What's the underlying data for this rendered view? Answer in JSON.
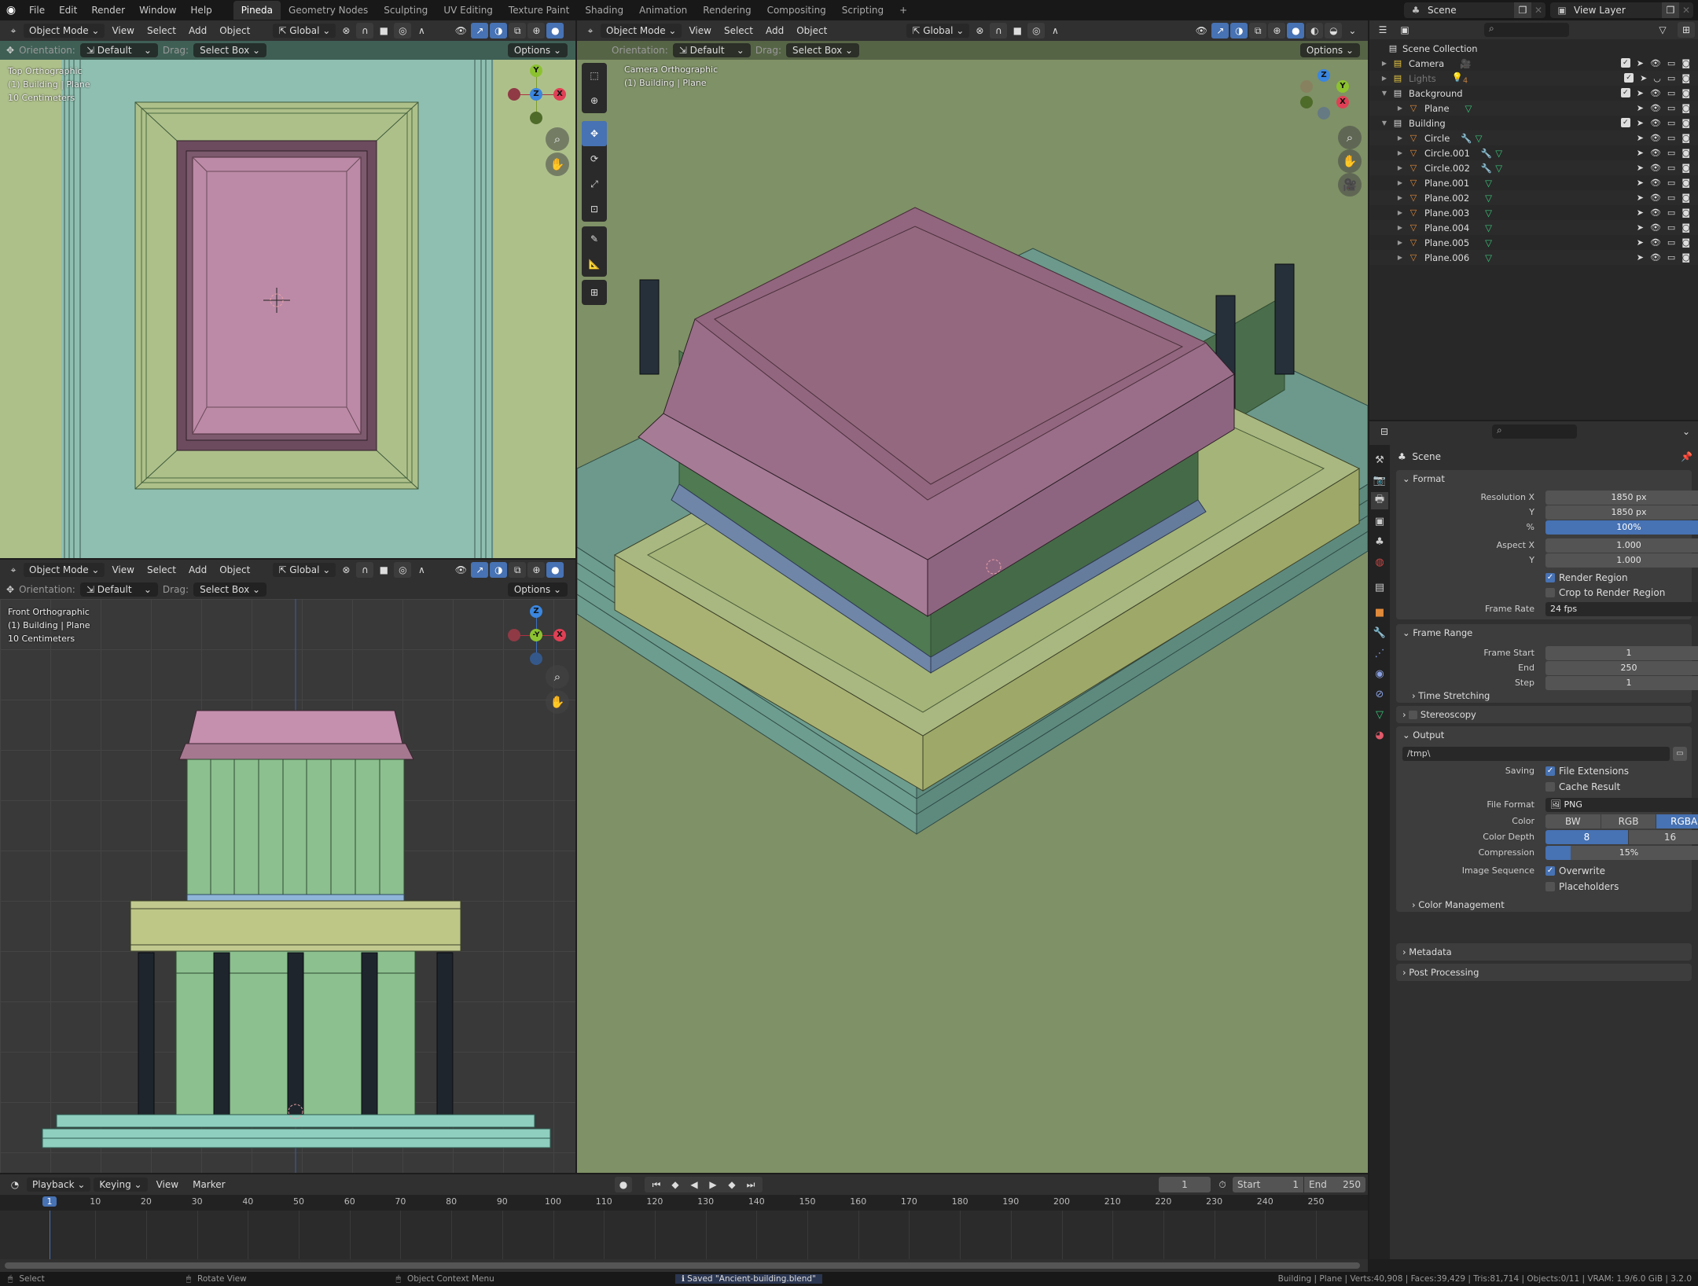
{
  "topbar": {
    "menus": [
      "File",
      "Edit",
      "Render",
      "Window",
      "Help"
    ],
    "workspaces": [
      "Pineda",
      "Geometry Nodes",
      "Sculpting",
      "UV Editing",
      "Texture Paint",
      "Shading",
      "Animation",
      "Rendering",
      "Compositing",
      "Scripting"
    ],
    "active_workspace": "Pineda",
    "add_tab": "+",
    "scene": "Scene",
    "view_layer": "View Layer"
  },
  "viewport_header": {
    "mode": "Object Mode",
    "menus": [
      "View",
      "Select",
      "Add",
      "Object"
    ],
    "transform_orientation": "Global",
    "orientation_label": "Orientation:",
    "orientation_value": "Default",
    "drag_label": "Drag:",
    "drag_value": "Select Box",
    "options": "Options"
  },
  "viewports": {
    "top": {
      "view": "Top Orthographic",
      "object": "(1) Building | Plane",
      "scale": "10 Centimeters"
    },
    "front": {
      "view": "Front Orthographic",
      "object": "(1) Building | Plane",
      "scale": "10 Centimeters"
    },
    "camera": {
      "view": "Camera Orthographic",
      "object": "(1) Building | Plane"
    }
  },
  "gizmo_labels": {
    "x": "X",
    "y": "Y",
    "z": "Z",
    "neg_y": "-Y"
  },
  "outliner": {
    "root": "Scene Collection",
    "items": [
      {
        "name": "Camera",
        "type": "collection",
        "depth": 0,
        "expanded": false,
        "extra": "camera-data"
      },
      {
        "name": "Lights",
        "type": "collection",
        "depth": 0,
        "expanded": false,
        "extra": "light-data",
        "count": "4",
        "disabled": true
      },
      {
        "name": "Background",
        "type": "collection",
        "depth": 0,
        "expanded": true
      },
      {
        "name": "Plane",
        "type": "mesh",
        "depth": 1
      },
      {
        "name": "Building",
        "type": "collection",
        "depth": 0,
        "expanded": true
      },
      {
        "name": "Circle",
        "type": "mesh",
        "depth": 1,
        "modifier": true
      },
      {
        "name": "Circle.001",
        "type": "mesh",
        "depth": 1,
        "modifier": true
      },
      {
        "name": "Circle.002",
        "type": "mesh",
        "depth": 1,
        "modifier": true
      },
      {
        "name": "Plane.001",
        "type": "mesh",
        "depth": 1
      },
      {
        "name": "Plane.002",
        "type": "mesh",
        "depth": 1
      },
      {
        "name": "Plane.003",
        "type": "mesh",
        "depth": 1
      },
      {
        "name": "Plane.004",
        "type": "mesh",
        "depth": 1
      },
      {
        "name": "Plane.005",
        "type": "mesh",
        "depth": 1
      },
      {
        "name": "Plane.006",
        "type": "mesh",
        "depth": 1
      }
    ]
  },
  "properties": {
    "context": "Scene",
    "format": {
      "title": "Format",
      "resolution_x_label": "Resolution X",
      "resolution_x": "1850 px",
      "resolution_y_label": "Y",
      "resolution_y": "1850 px",
      "percent_label": "%",
      "percent": "100%",
      "aspect_x_label": "Aspect X",
      "aspect_x": "1.000",
      "aspect_y_label": "Y",
      "aspect_y": "1.000",
      "render_region": "Render Region",
      "render_region_checked": true,
      "crop_region": "Crop to Render Region",
      "crop_region_checked": false,
      "frame_rate_label": "Frame Rate",
      "frame_rate": "24 fps"
    },
    "frame_range": {
      "title": "Frame Range",
      "start_label": "Frame Start",
      "start": "1",
      "end_label": "End",
      "end": "250",
      "step_label": "Step",
      "step": "1",
      "time_stretching": "Time Stretching"
    },
    "stereoscopy": "Stereoscopy",
    "output": {
      "title": "Output",
      "path": "/tmp\\",
      "saving_label": "Saving",
      "file_extensions": "File Extensions",
      "file_extensions_checked": true,
      "cache_result": "Cache Result",
      "cache_result_checked": false,
      "file_format_label": "File Format",
      "file_format": "PNG",
      "color_label": "Color",
      "color_options": [
        "BW",
        "RGB",
        "RGBA"
      ],
      "color_selected": "RGBA",
      "depth_label": "Color Depth",
      "depth_options": [
        "8",
        "16"
      ],
      "depth_selected": "8",
      "compression_label": "Compression",
      "compression": "15%",
      "compression_value": 0.15,
      "image_seq_label": "Image Sequence",
      "overwrite": "Overwrite",
      "overwrite_checked": true,
      "placeholders": "Placeholders",
      "placeholders_checked": false,
      "color_management": "Color Management"
    },
    "metadata": "Metadata",
    "post_processing": "Post Processing"
  },
  "timeline": {
    "menus": [
      "Playback",
      "Keying",
      "View",
      "Marker"
    ],
    "current_frame": "1",
    "start_label": "Start",
    "start": "1",
    "end_label": "End",
    "end": "250",
    "ticks": [
      "1",
      "10",
      "20",
      "30",
      "40",
      "50",
      "60",
      "70",
      "80",
      "90",
      "100",
      "110",
      "120",
      "130",
      "140",
      "150",
      "160",
      "170",
      "180",
      "190",
      "200",
      "210",
      "220",
      "230",
      "240",
      "250"
    ]
  },
  "statusbar": {
    "select": "Select",
    "rotate": "Rotate View",
    "context_menu": "Object Context Menu",
    "message": "Saved \"Ancient-building.blend\"",
    "stats": "Building | Plane | Verts:40,908 | Faces:39,429 | Tris:81,714 | Objects:0/11 | VRAM: 1.9/6.0 GiB | 3.2.0"
  },
  "colors": {
    "accent": "#4772b3",
    "viewport_bg_top": "#8fbfb0",
    "viewport_bg_camera": "#7f9166",
    "grid_bg": "#3a3a3a",
    "roof": "#b5809d",
    "walls": "#5d8a5d",
    "terrace": "#a9b880",
    "base": "#6c998b"
  }
}
